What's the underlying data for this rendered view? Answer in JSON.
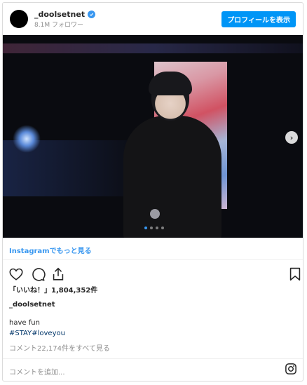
{
  "header": {
    "username": "_doolsetnet",
    "followers": "8.1M フォロワー",
    "profile_button": "プロフィールを表示"
  },
  "post": {
    "see_more_link": "Instagramでもっと見る",
    "carousel": {
      "slides": 4,
      "active_index": 0
    },
    "likes": "「いいね！」1,804,352件",
    "author": "_doolsetnet",
    "caption_line1": "have fun",
    "caption_line2": "#STAY#loveyou",
    "view_comments": "コメント22,174件をすべて見る",
    "add_comment_placeholder": "コメントを追加..."
  },
  "icons": {
    "verified": "verified-badge-icon",
    "next": "chevron-right-icon",
    "like": "heart-icon",
    "comment": "comment-bubble-icon",
    "share": "share-icon",
    "save": "bookmark-icon",
    "brand": "instagram-icon"
  },
  "colors": {
    "accent": "#0095f6",
    "link": "#3897f0",
    "hashtag": "#003569",
    "muted": "#8e8e8e"
  }
}
